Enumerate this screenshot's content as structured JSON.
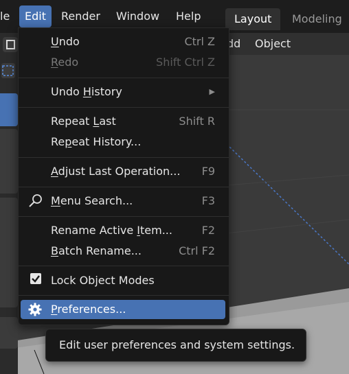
{
  "menubar": {
    "items": [
      "le",
      "Edit",
      "Render",
      "Window",
      "Help"
    ],
    "workspaces": [
      "Layout",
      "Modeling"
    ]
  },
  "viewport_header": {
    "items": [
      "dd",
      "Object"
    ]
  },
  "edit_menu": {
    "undo": {
      "label": "Undo",
      "shortcut": "Ctrl Z"
    },
    "redo": {
      "label": "Redo",
      "shortcut": "Shift Ctrl Z"
    },
    "undo_history": {
      "label": "Undo History"
    },
    "repeat_last": {
      "label": "Repeat Last",
      "shortcut": "Shift R"
    },
    "repeat_history": {
      "label": "Repeat History..."
    },
    "adjust_last": {
      "label": "Adjust Last Operation...",
      "shortcut": "F9"
    },
    "menu_search": {
      "label": "Menu Search...",
      "shortcut": "F3"
    },
    "rename_active": {
      "label": "Rename Active Item...",
      "shortcut": "F2"
    },
    "batch_rename": {
      "label": "Batch Rename...",
      "shortcut": "Ctrl F2"
    },
    "lock_object_modes": {
      "label": "Lock Object Modes",
      "checked": true
    },
    "preferences": {
      "label": "Preferences..."
    }
  },
  "tooltip": {
    "text": "Edit user preferences and system settings."
  },
  "colors": {
    "accent": "#4772b3",
    "menu_bg": "#181818",
    "viewport_bg": "#3a3a3a"
  }
}
